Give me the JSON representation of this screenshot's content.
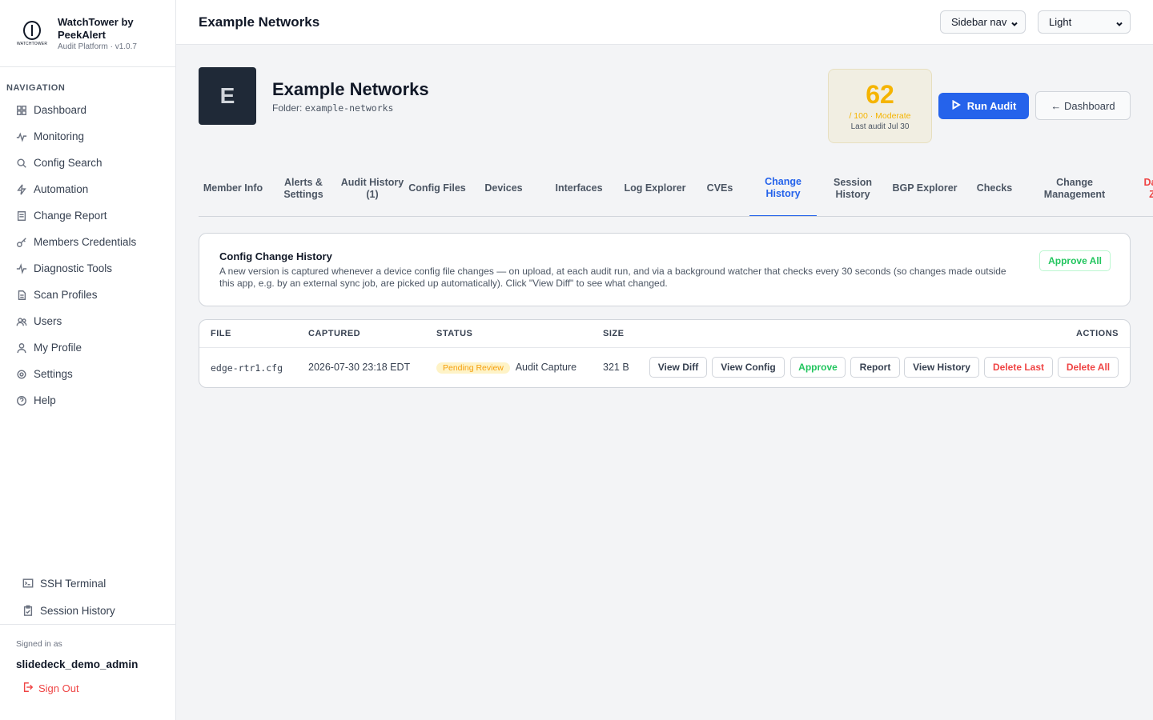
{
  "brand": {
    "logo_text": "WATCHTOWER",
    "title": "WatchTower by PeekAlert",
    "subtitle": "Audit Platform · v1.0.7"
  },
  "nav": {
    "heading": "NAVIGATION",
    "items": [
      {
        "label": "Dashboard",
        "icon": "grid-icon"
      },
      {
        "label": "Monitoring",
        "icon": "activity-icon"
      },
      {
        "label": "Config Search",
        "icon": "search-icon"
      },
      {
        "label": "Automation",
        "icon": "bolt-icon"
      },
      {
        "label": "Change Report",
        "icon": "document-icon"
      },
      {
        "label": "Members Credentials",
        "icon": "key-icon"
      },
      {
        "label": "Diagnostic Tools",
        "icon": "pulse-icon"
      },
      {
        "label": "Scan Profiles",
        "icon": "file-icon"
      },
      {
        "label": "Users",
        "icon": "users-icon"
      },
      {
        "label": "My Profile",
        "icon": "user-icon"
      },
      {
        "label": "Settings",
        "icon": "gear-icon"
      },
      {
        "label": "Help",
        "icon": "help-icon"
      }
    ],
    "bottom": [
      {
        "label": "SSH Terminal",
        "icon": "terminal-icon"
      },
      {
        "label": "Session History",
        "icon": "clipboard-icon"
      }
    ]
  },
  "account": {
    "signed_in_label": "Signed in as",
    "username": "slidedeck_demo_admin",
    "sign_out": "Sign Out"
  },
  "topbar": {
    "title": "Example Networks",
    "nav_select": "Sidebar nav",
    "theme_select": "Light"
  },
  "org": {
    "avatar_letter": "E",
    "name": "Example Networks",
    "folder_label": "Folder:",
    "folder": "example-networks"
  },
  "score": {
    "value": "62",
    "detail": "/ 100 · Moderate",
    "last_audit": "Last audit Jul 30"
  },
  "actions": {
    "run_audit": "Run Audit",
    "dashboard": "← Dashboard"
  },
  "tabs": [
    {
      "label": "Member Info"
    },
    {
      "label": "Alerts & Settings"
    },
    {
      "label": "Audit History (1)"
    },
    {
      "label": "Config Files"
    },
    {
      "label": "Devices"
    },
    {
      "label": "Interfaces"
    },
    {
      "label": "Log Explorer"
    },
    {
      "label": "CVEs"
    },
    {
      "label": "Change History",
      "active": true
    },
    {
      "label": "Session History"
    },
    {
      "label": "BGP Explorer"
    },
    {
      "label": "Checks"
    },
    {
      "label": "Change Management"
    },
    {
      "label": "Danger Zone"
    }
  ],
  "info_card": {
    "title": "Config Change History",
    "description": "A new version is captured whenever a device config file changes — on upload, at each audit run, and via a background watcher that checks every 30 seconds (so changes made outside this app, e.g. by an external sync job, are picked up automatically). Click \"View Diff\" to see what changed.",
    "approve_all": "Approve All"
  },
  "table": {
    "headers": [
      "FILE",
      "CAPTURED",
      "STATUS",
      "SIZE",
      "ACTIONS"
    ],
    "rows": [
      {
        "file": "edge-rtr1.cfg",
        "captured": "2026-07-30 23:18 EDT",
        "status_badge": "Pending Review",
        "status_text": "Audit Capture",
        "size": "321 B",
        "actions": [
          "View Diff",
          "View Config",
          "Approve",
          "Report",
          "View History",
          "Delete Last",
          "Delete All"
        ]
      }
    ]
  }
}
